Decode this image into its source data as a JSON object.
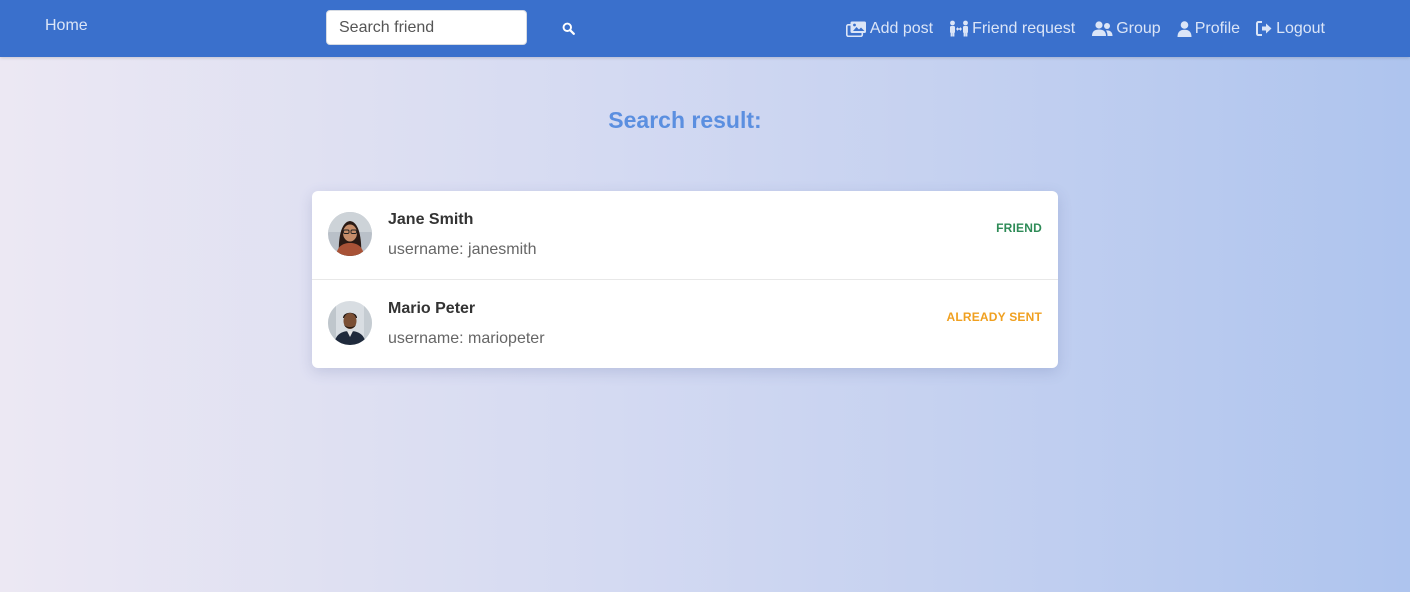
{
  "nav": {
    "home": "Home",
    "search_placeholder": "Search friend",
    "links": {
      "add_post": "Add post",
      "friend_request": "Friend request",
      "group": "Group",
      "profile": "Profile",
      "logout": "Logout"
    }
  },
  "main": {
    "title": "Search result:",
    "results": [
      {
        "name": "Jane Smith",
        "username": "username: janesmith",
        "status": "FRIEND",
        "avatar_icon": "person-photo-avatar"
      },
      {
        "name": "Mario Peter",
        "username": "username: mariopeter",
        "status": "ALREADY SENT",
        "avatar_icon": "person-photo-avatar"
      }
    ]
  },
  "colors": {
    "navbar": "#3a70cc",
    "title": "#5b8fe0",
    "friend_status": "#2e8b57",
    "sent_status": "#f0a020"
  }
}
